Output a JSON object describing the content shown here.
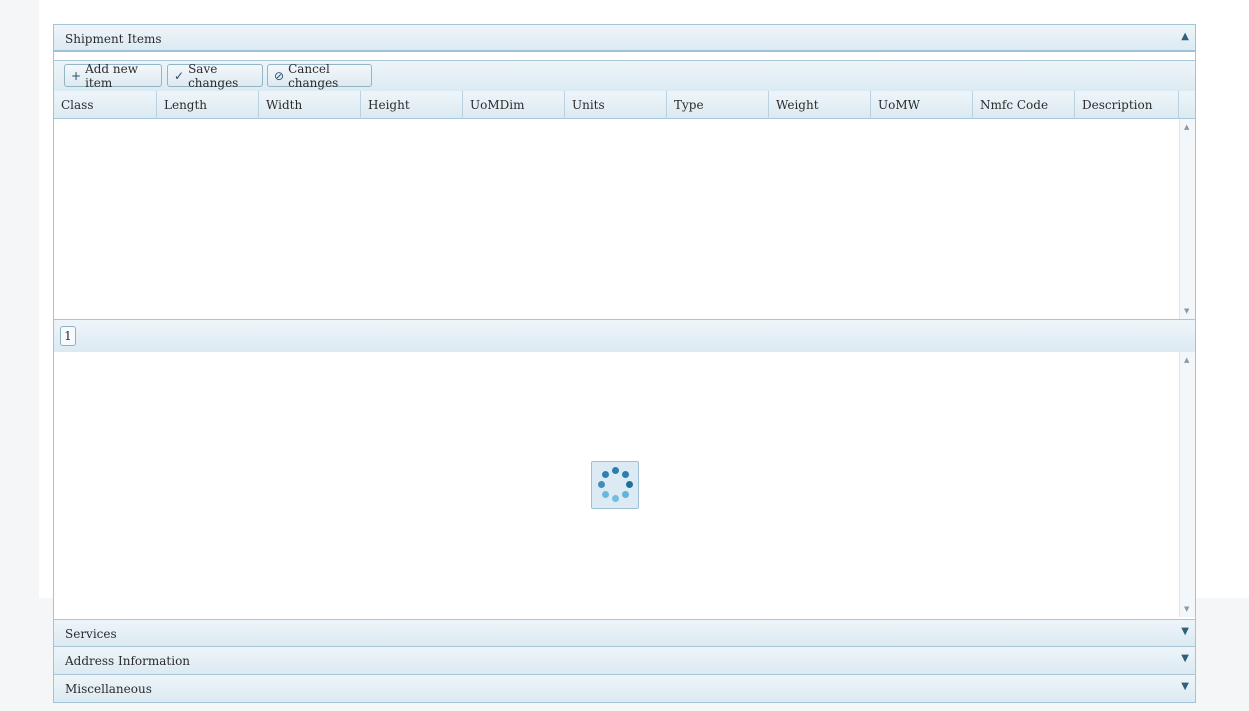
{
  "panels": {
    "shipment_items": {
      "label": "Shipment Items",
      "arrow": "▲"
    },
    "services": {
      "label": "Services",
      "arrow": "▼"
    },
    "address": {
      "label": "Address Information",
      "arrow": "▼"
    },
    "misc": {
      "label": "Miscellaneous",
      "arrow": "▼"
    }
  },
  "toolbar": {
    "add_label": "Add new item",
    "save_label": "Save changes",
    "cancel_label": "Cancel changes",
    "add_icon": "plus-icon",
    "save_icon": "check-icon",
    "cancel_icon": "cancel-icon"
  },
  "grid": {
    "columns": [
      "Class",
      "Length",
      "Width",
      "Height",
      "UoMDim",
      "Units",
      "Type",
      "Weight",
      "UoMW",
      "Nmfc Code",
      "Description"
    ],
    "rows": []
  },
  "pager": {
    "current_page": "1"
  },
  "loading": {
    "icon": "loading-spinner-icon"
  },
  "colors": {
    "accent": "#2f6f93",
    "header_bg": "#dceaf2",
    "border": "#a3c3d6"
  }
}
